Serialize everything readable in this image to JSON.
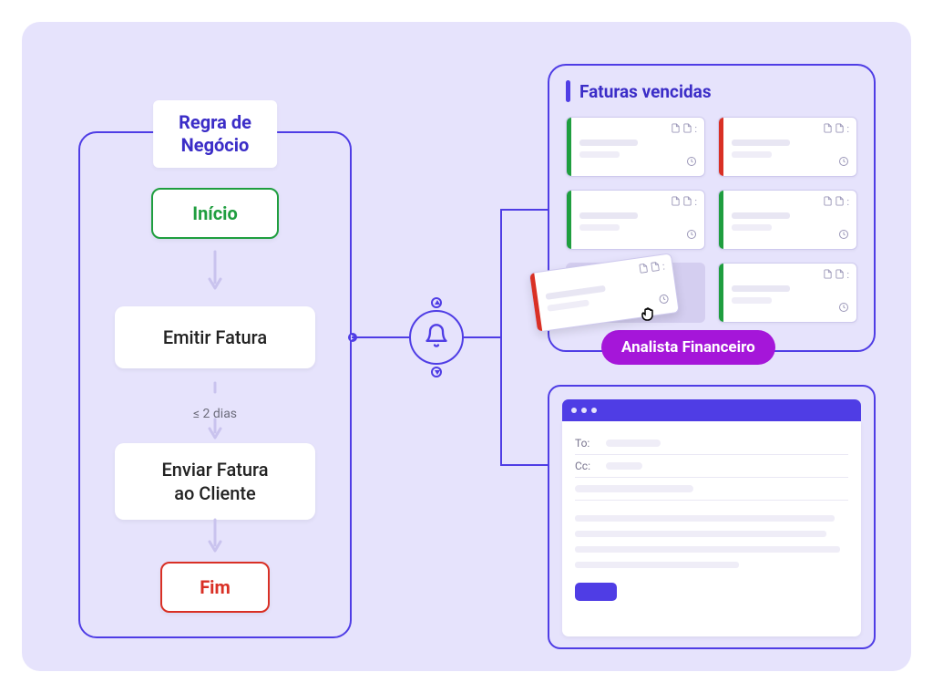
{
  "workflow": {
    "title": "Regra de\nNegócio",
    "start": "Início",
    "step1": "Emitir Fatura",
    "sla": "≤ 2 dias",
    "step2": "Enviar Fatura\nao Cliente",
    "end": "Fim"
  },
  "kanban": {
    "title": "Faturas vencidas",
    "cards": [
      {
        "stripe": "green"
      },
      {
        "stripe": "red"
      },
      {
        "stripe": "green"
      },
      {
        "stripe": "green"
      },
      {
        "stripe": "placeholder"
      },
      {
        "stripe": "green"
      }
    ],
    "dragging": {
      "stripe": "red"
    }
  },
  "role_badge": "Analista Financeiro",
  "email": {
    "to_label": "To:",
    "cc_label": "Cc:"
  },
  "colors": {
    "primary": "#4F3DE5",
    "background": "#E6E3FC",
    "green": "#1F9E3F",
    "red": "#D93025",
    "purple": "#A516D9"
  }
}
